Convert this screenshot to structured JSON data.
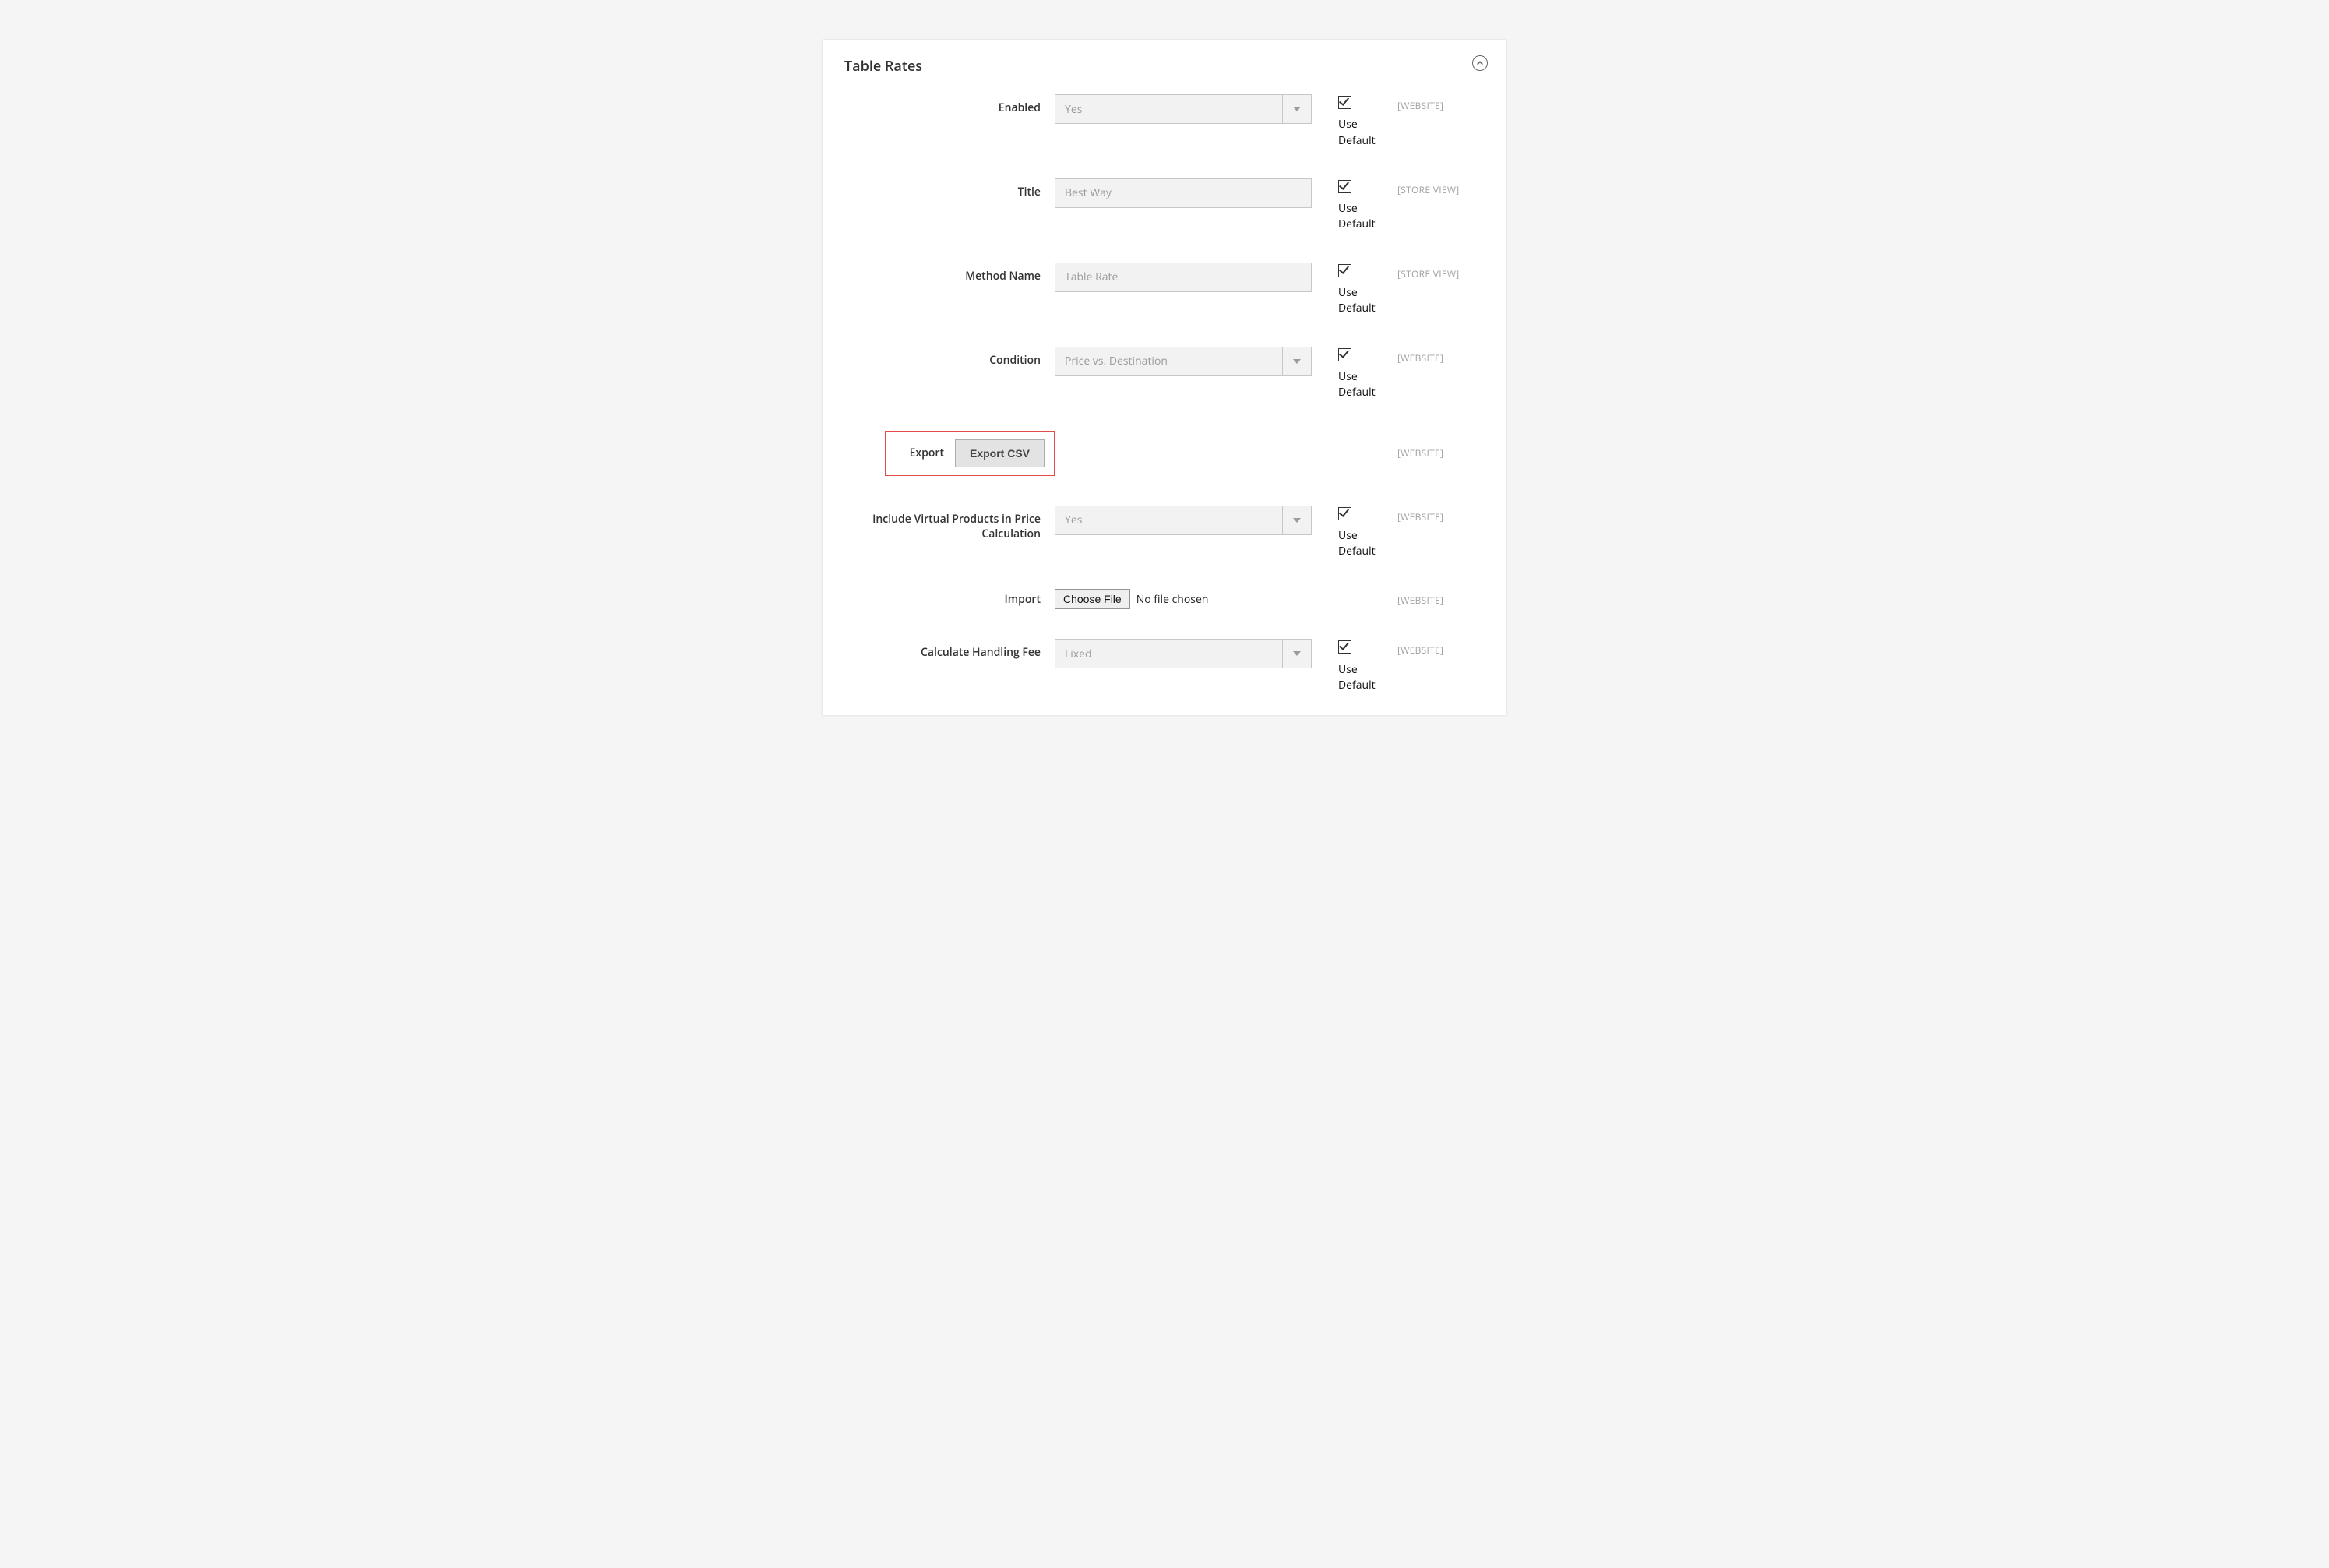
{
  "panel": {
    "title": "Table Rates"
  },
  "scopes": {
    "website": "[WEBSITE]",
    "store_view": "[STORE VIEW]"
  },
  "use_default_label": "Use Default",
  "fields": {
    "enabled": {
      "label": "Enabled",
      "value": "Yes",
      "scope": "[WEBSITE]",
      "use_default": true
    },
    "title": {
      "label": "Title",
      "value": "Best Way",
      "scope": "[STORE VIEW]",
      "use_default": true
    },
    "method_name": {
      "label": "Method Name",
      "value": "Table Rate",
      "scope": "[STORE VIEW]",
      "use_default": true
    },
    "condition": {
      "label": "Condition",
      "value": "Price vs. Destination",
      "scope": "[WEBSITE]",
      "use_default": true
    },
    "export": {
      "label": "Export",
      "button": "Export CSV",
      "scope": "[WEBSITE]"
    },
    "include_virtual": {
      "label": "Include Virtual Products in Price Calculation",
      "value": "Yes",
      "scope": "[WEBSITE]",
      "use_default": true
    },
    "import": {
      "label": "Import",
      "button": "Choose File",
      "file_status": "No file chosen",
      "scope": "[WEBSITE]"
    },
    "handling_fee": {
      "label": "Calculate Handling Fee",
      "value": "Fixed",
      "scope": "[WEBSITE]",
      "use_default": true
    }
  }
}
